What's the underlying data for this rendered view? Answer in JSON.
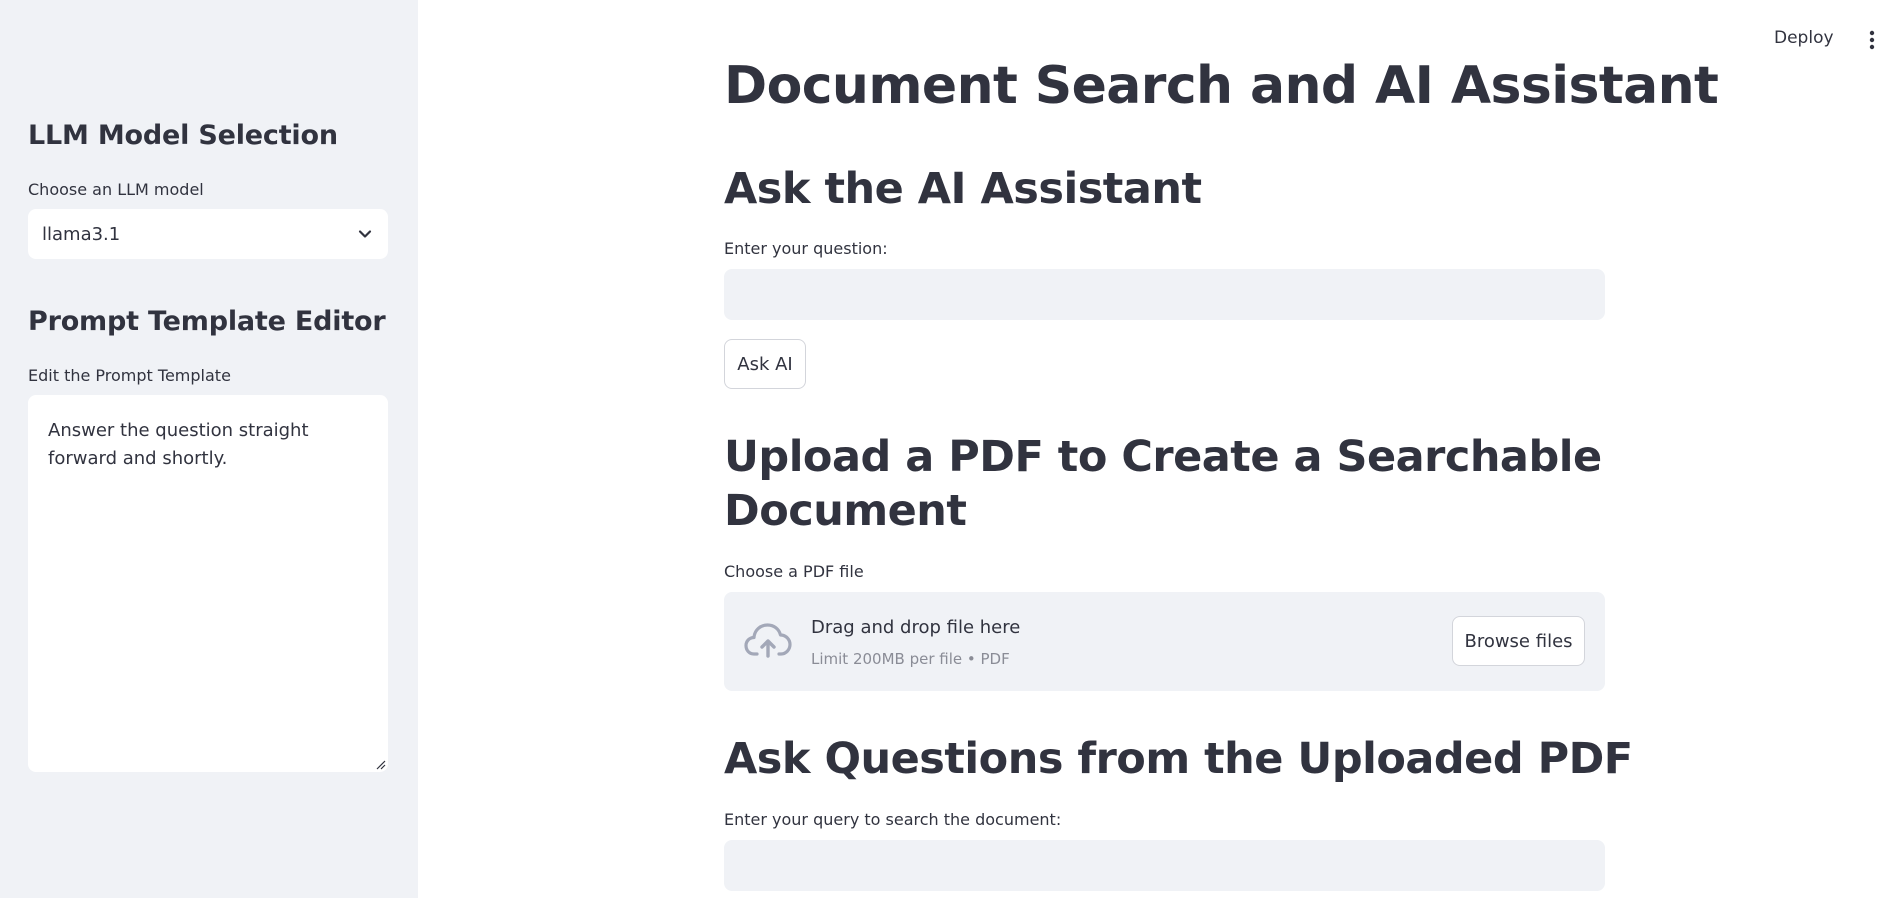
{
  "header": {
    "deploy_label": "Deploy",
    "menu_icon": "kebab-menu-icon"
  },
  "sidebar": {
    "model_section": {
      "heading": "LLM Model Selection",
      "select_label": "Choose an LLM model",
      "selected_value": "llama3.1",
      "chevron_icon": "chevron-down-icon"
    },
    "prompt_section": {
      "heading": "Prompt Template Editor",
      "textarea_label": "Edit the Prompt Template",
      "textarea_value": "Answer the question straight forward and shortly."
    }
  },
  "main": {
    "title": "Document Search and AI Assistant",
    "ask_section": {
      "heading": "Ask the AI Assistant",
      "input_label": "Enter your question:",
      "input_value": "",
      "button_label": "Ask AI"
    },
    "upload_section": {
      "heading_line1": "Upload a PDF to Create a Searchable",
      "heading_line2": "Document",
      "uploader_label": "Choose a PDF file",
      "drop_title": "Drag and drop file here",
      "drop_subtitle": "Limit 200MB per file • PDF",
      "browse_label": "Browse files",
      "upload_icon": "cloud-upload-icon"
    },
    "query_section": {
      "heading": "Ask Questions from the Uploaded PDF",
      "input_label": "Enter your query to search the document:",
      "input_value": ""
    }
  },
  "colors": {
    "sidebar_bg": "#f0f2f6",
    "input_bg": "#f0f2f6",
    "text": "#31333f",
    "muted_text": "#8a8c96",
    "icon_gray": "#a3a8b8"
  }
}
